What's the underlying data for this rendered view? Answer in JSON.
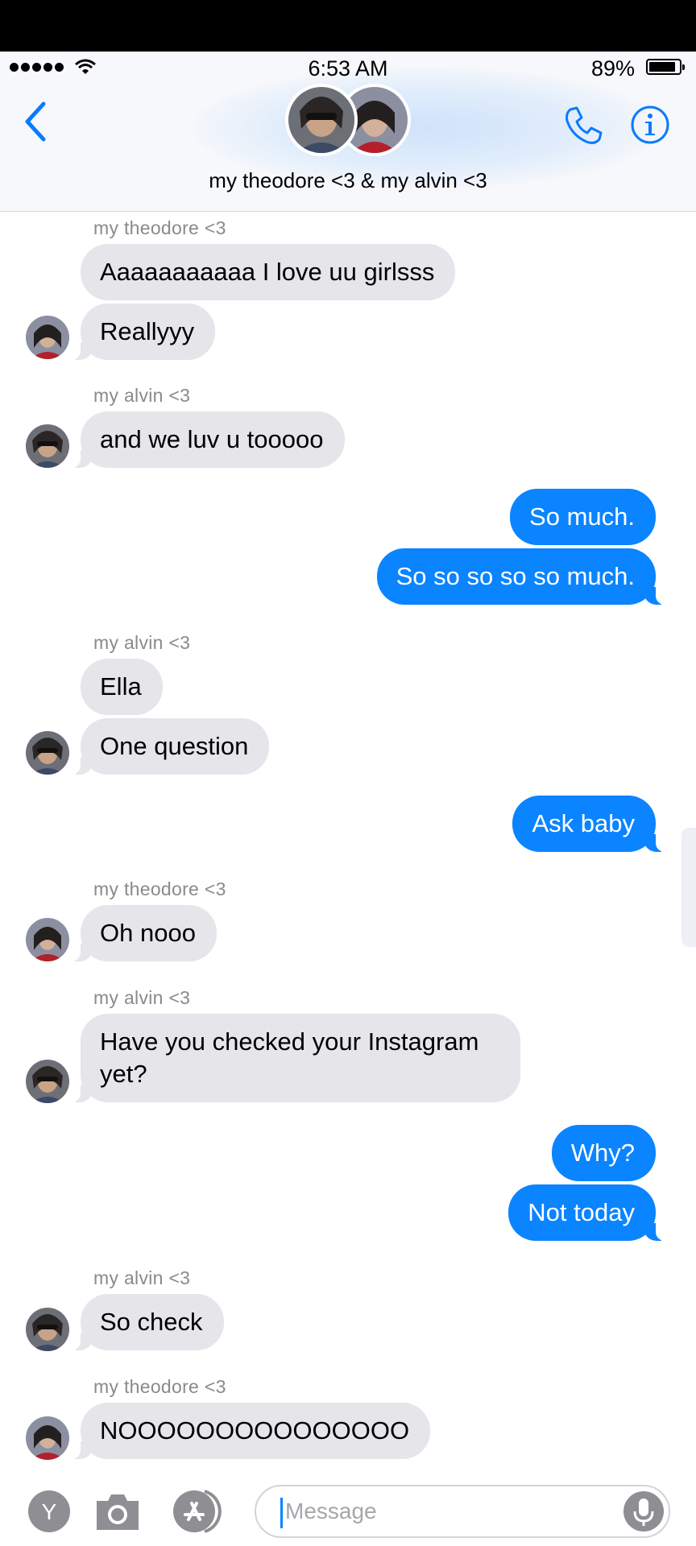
{
  "status_bar": {
    "time": "6:53 AM",
    "battery_pct": "89%",
    "battery_level": 0.89
  },
  "header": {
    "thread_name": "my theodore <3 & my alvin <3",
    "back_icon": "chevron-left-icon",
    "call_icon": "phone-icon",
    "info_icon": "info-icon"
  },
  "messages": [
    {
      "sender": "my theodore <3",
      "text": "Aaaaaaaaaaa I love uu girlsss",
      "dir": "in"
    },
    {
      "text": "Reallyyy",
      "dir": "in"
    },
    {
      "sender": "my alvin <3",
      "text": "and we luv u tooooo",
      "dir": "in"
    },
    {
      "text": "So much.",
      "dir": "out"
    },
    {
      "text": "So so so so so much.",
      "dir": "out"
    },
    {
      "sender": "my alvin <3",
      "text": "Ella",
      "dir": "in"
    },
    {
      "text": "One question",
      "dir": "in"
    },
    {
      "text": "Ask baby",
      "dir": "out"
    },
    {
      "sender": "my theodore <3",
      "text": "Oh nooo",
      "dir": "in"
    },
    {
      "sender": "my alvin <3",
      "text": "Have you checked your Instagram yet?",
      "dir": "in"
    },
    {
      "text": "Why?",
      "dir": "out"
    },
    {
      "text": "Not today",
      "dir": "out"
    },
    {
      "sender": "my alvin <3",
      "text": "So check",
      "dir": "in"
    },
    {
      "sender": "my theodore <3",
      "text": "NOOOOOOOOOOOOOOO",
      "dir": "in"
    }
  ],
  "composer": {
    "placeholder": "Message",
    "app_y_label": "Y",
    "icons": [
      "app-y-icon",
      "camera-icon",
      "app-store-icon",
      "microphone-icon"
    ]
  },
  "colors": {
    "outgoing": "#0b84ff",
    "incoming": "#e5e5ea",
    "accent": "#0a7aff"
  }
}
